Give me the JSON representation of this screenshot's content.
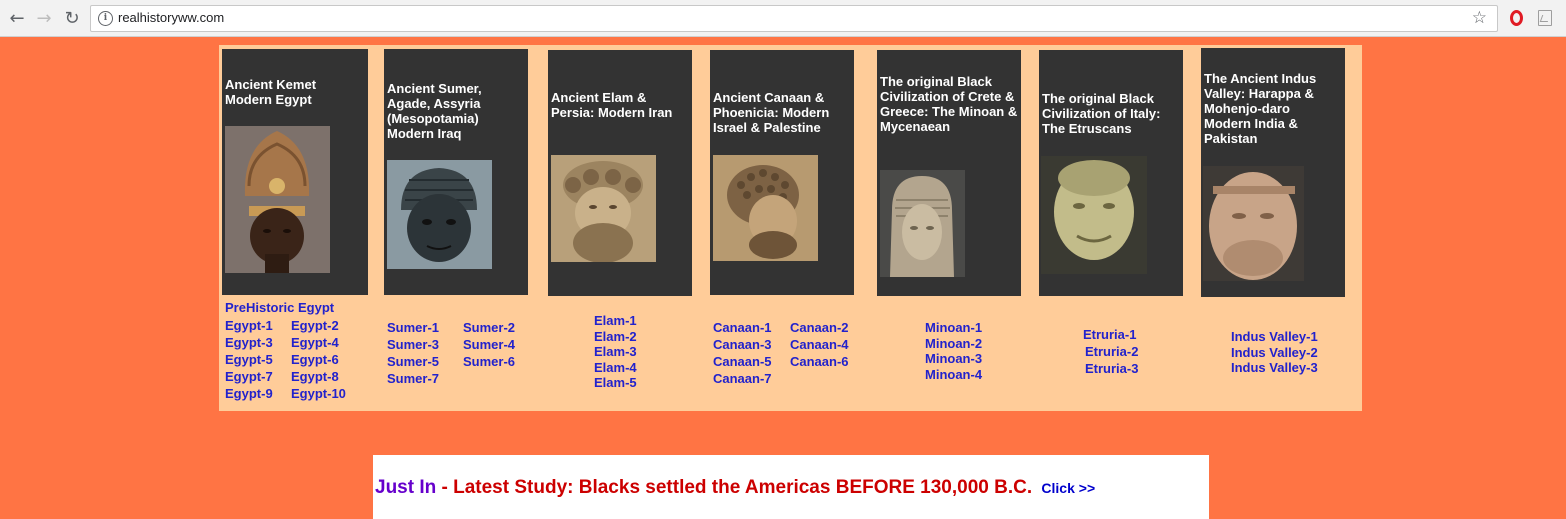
{
  "browser": {
    "url": "realhistoryww.com",
    "icons": {
      "back": "arrow-left-icon",
      "forward": "arrow-right-icon",
      "reload": "reload-icon",
      "info": "info-icon",
      "bookmark": "star-icon",
      "opera": "opera-extension-icon",
      "pdf": "pdf-extension-icon"
    }
  },
  "colors": {
    "page_bg": "#ff7444",
    "panel_bg": "#ffcc99",
    "card_bg": "#333333",
    "link": "#2222cc",
    "just_in": "#6600cc",
    "headline": "#cc0000"
  },
  "cards": [
    {
      "title": "Ancient Kemet Modern Egypt",
      "links": [
        "PreHistoric Egypt",
        "Egypt-1",
        "Egypt-2",
        "Egypt-3",
        "Egypt-4",
        "Egypt-5",
        "Egypt-6",
        "Egypt-7",
        "Egypt-8",
        "Egypt-9",
        "Egypt-10"
      ]
    },
    {
      "title": "Ancient Sumer, Agade, Assyria (Mesopotamia) Modern Iraq",
      "links": [
        "Sumer-1",
        "Sumer-2",
        "Sumer-3",
        "Sumer-4",
        "Sumer-5",
        "Sumer-6",
        "Sumer-7"
      ]
    },
    {
      "title": "Ancient Elam & Persia:  Modern Iran",
      "links": [
        "Elam-1",
        "Elam-2",
        "Elam-3",
        "Elam-4",
        "Elam-5"
      ]
    },
    {
      "title": "Ancient Canaan & Phoenicia: Modern Israel & Palestine",
      "links": [
        "Canaan-1",
        "Canaan-2",
        "Canaan-3",
        "Canaan-4",
        "Canaan-5",
        "Canaan-6",
        "Canaan-7"
      ]
    },
    {
      "title": "The original Black Civilization of Crete & Greece: The Minoan & Mycenaean",
      "links": [
        "Minoan-1",
        "Minoan-2",
        "Minoan-3",
        "Minoan-4"
      ]
    },
    {
      "title": "The original Black Civilization of Italy: The Etruscans",
      "links": [
        "Etruria-1",
        "Etruria-2",
        "Etruria-3"
      ]
    },
    {
      "title": "The Ancient Indus Valley: Harappa & Mohenjo-daro Modern India & Pakistan",
      "links": [
        "Indus Valley-1",
        "Indus Valley-2",
        "Indus Valley-3"
      ]
    }
  ],
  "banner": {
    "just_in": "Just In",
    "headline": " - Latest Study: Blacks settled the Americas BEFORE 130,000 B.C.",
    "click": "Click >>"
  }
}
